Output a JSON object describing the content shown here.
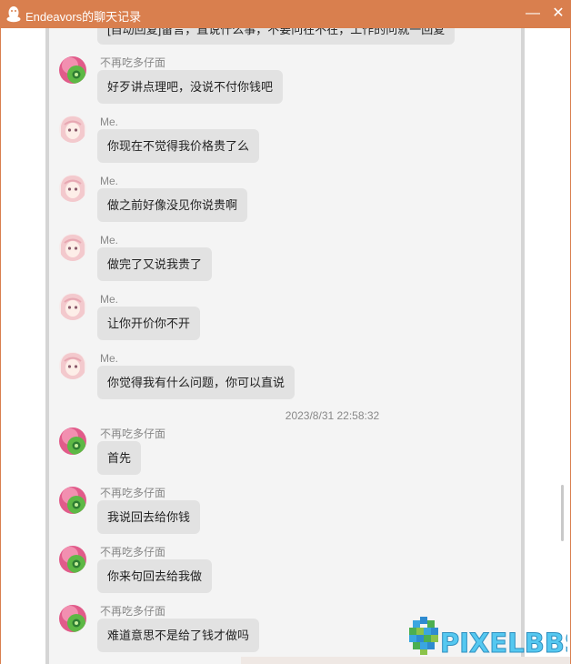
{
  "window": {
    "title": "Endeavors的聊天记录",
    "minimize_glyph": "—",
    "close_glyph": "✕",
    "accent_color": "#d97f4e"
  },
  "chat": {
    "clipped_message": "[自动回复]留言，直说什么事，不要问在不在，工作的问就一回复",
    "messages_before": [
      {
        "sender": "不再吃多仔面",
        "text": "好歹讲点理吧，没说不付你钱吧",
        "avatar": "green-pink-avatar"
      },
      {
        "sender": "Me.",
        "text": "你现在不觉得我价格贵了么",
        "avatar": "anime-girl-avatar"
      },
      {
        "sender": "Me.",
        "text": "做之前好像没见你说贵啊",
        "avatar": "anime-girl-avatar"
      },
      {
        "sender": "Me.",
        "text": "做完了又说我贵了",
        "avatar": "anime-girl-avatar"
      },
      {
        "sender": "Me.",
        "text": "让你开价你不开",
        "avatar": "anime-girl-avatar"
      },
      {
        "sender": "Me.",
        "text": "你觉得我有什么问题，你可以直说",
        "avatar": "anime-girl-avatar"
      }
    ],
    "timestamp": "2023/8/31 22:58:32",
    "messages_after": [
      {
        "sender": "不再吃多仔面",
        "text": "首先",
        "avatar": "green-pink-avatar"
      },
      {
        "sender": "不再吃多仔面",
        "text": "我说回去给你钱",
        "avatar": "green-pink-avatar"
      },
      {
        "sender": "不再吃多仔面",
        "text": "你来句回去给我做",
        "avatar": "green-pink-avatar"
      },
      {
        "sender": "不再吃多仔面",
        "text": "难道意思不是给了钱才做吗",
        "avatar": "green-pink-avatar"
      }
    ]
  },
  "watermark": {
    "text": "PIXELBBS"
  }
}
